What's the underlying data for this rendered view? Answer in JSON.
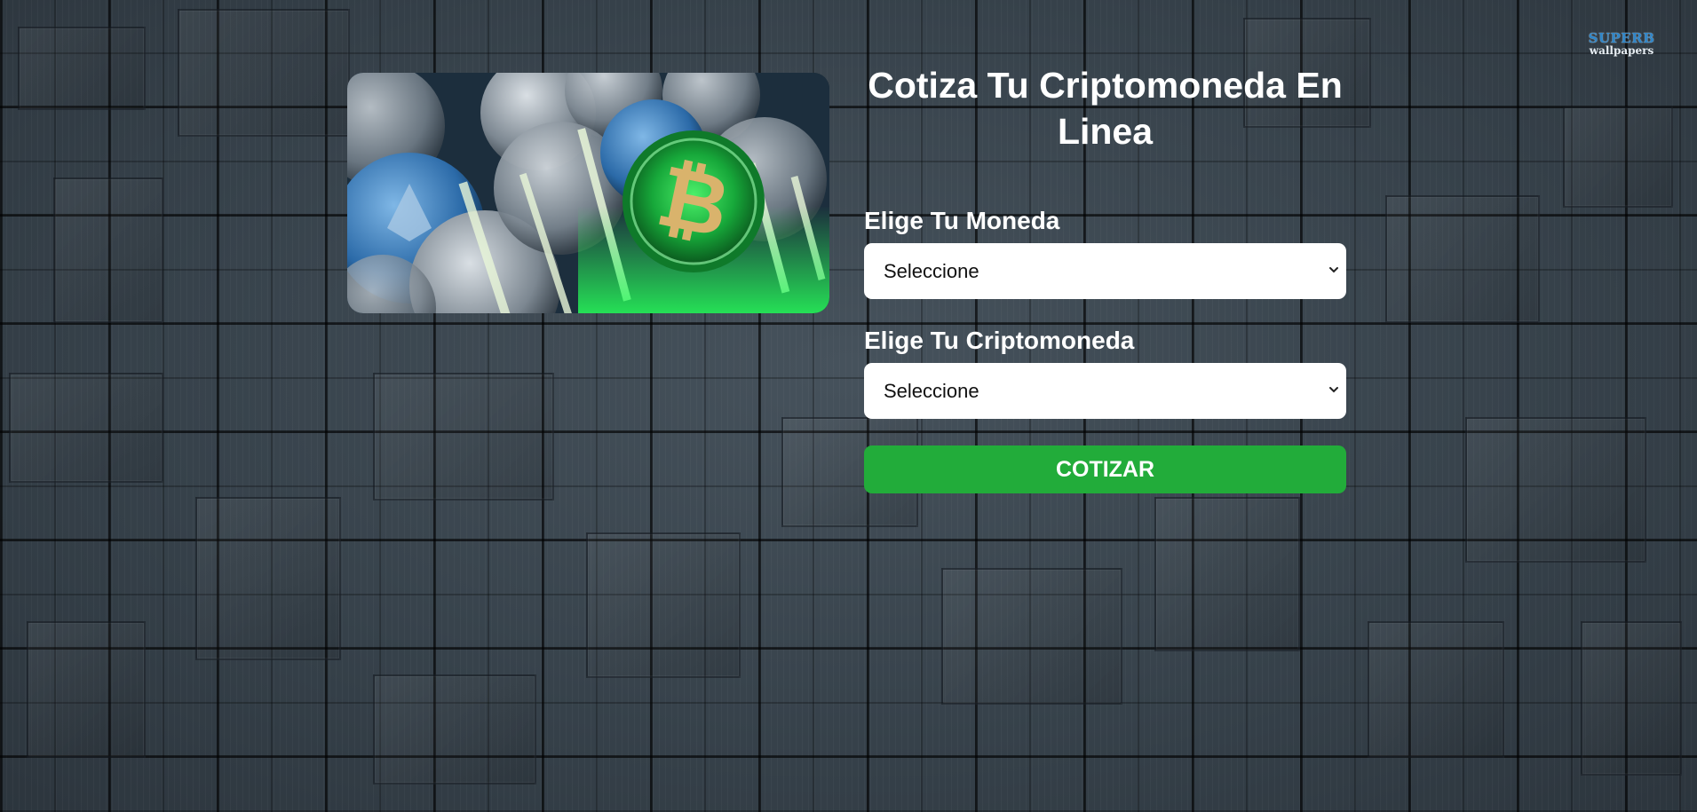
{
  "watermark": {
    "line1": "SUPERB",
    "line2": "wallpapers"
  },
  "hero": {
    "icon": "bitcoin-coin-icon"
  },
  "title": "Cotiza Tu Criptomoneda En Linea",
  "form": {
    "currency_label": "Elige Tu Moneda",
    "currency_value": "Seleccione",
    "crypto_label": "Elige Tu Criptomoneda",
    "crypto_value": "Seleccione",
    "submit_label": "COTIZAR"
  },
  "colors": {
    "button": "#22ac3a",
    "text": "#ffffff",
    "select_bg": "#ffffff"
  }
}
